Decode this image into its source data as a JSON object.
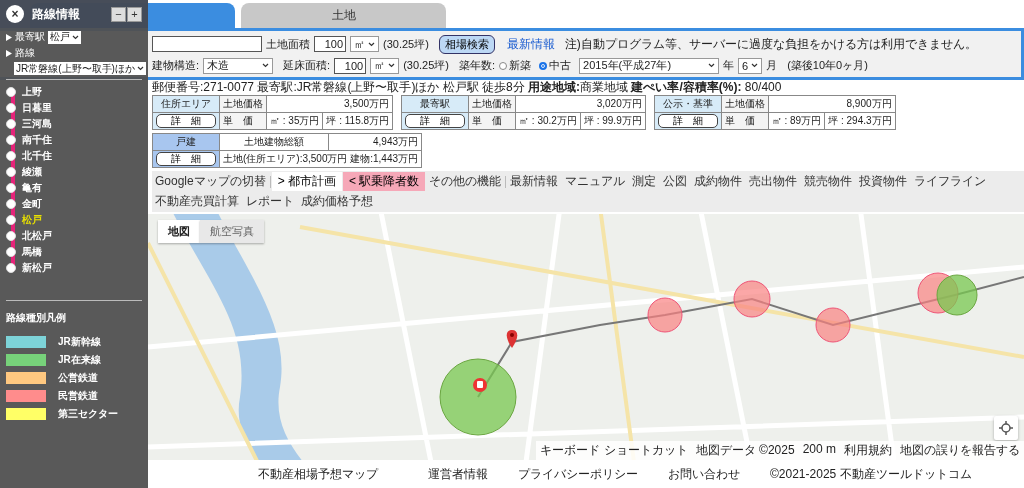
{
  "tabs": [
    {
      "selected": true
    },
    {
      "label": "土地",
      "selected": false
    }
  ],
  "search_form": {
    "land_area": {
      "label": "土地面積",
      "value": "100",
      "unit": "㎡",
      "tsubo": "(30.25坪)"
    },
    "search_button": "相場検索",
    "news_link": "最新情報",
    "notice": "注)自動プログラム等、サーバーに過度な負担をかける方は利用できません。",
    "structure": {
      "label": "建物構造:",
      "value": "木造"
    },
    "floor_area": {
      "label": "延床面積:",
      "value": "100",
      "unit": "㎡",
      "tsubo": "(30.25坪)"
    },
    "age": {
      "label": "築年数:",
      "options": [
        {
          "label": "新築",
          "selected": false
        },
        {
          "label": "中古",
          "selected": true
        }
      ],
      "year": "2015年(平成27年)",
      "year_unit": "年",
      "month": "6",
      "month_unit": "月",
      "elapsed": "(築後10年0ヶ月)"
    }
  },
  "info_line": "郵便番号:271-0077 最寄駅:JR常磐線(上野〜取手)ほか 松戸駅 徒歩8分 **用途地域:**商業地域 **建ぺい率/容積率(%):** 80/400",
  "price_cards": [
    {
      "kind": "land",
      "title": "住所エリア",
      "button": "詳　細",
      "price_label": "土地価格",
      "price": "3,500万円",
      "unit_label": "単　価",
      "sqm": "㎡ : 35万円",
      "tsubo": "坪 : 115.8万円"
    },
    {
      "kind": "land",
      "title": "最寄駅",
      "button": "詳　細",
      "price_label": "土地価格",
      "price": "3,020万円",
      "unit_label": "単　価",
      "sqm": "㎡ : 30.2万円",
      "tsubo": "坪 : 99.9万円"
    },
    {
      "kind": "land",
      "title": "公示・基準",
      "button": "詳　細",
      "price_label": "土地価格",
      "price": "8,900万円",
      "unit_label": "単　価",
      "sqm": "㎡ : 89万円",
      "tsubo": "坪 : 294.3万円"
    },
    {
      "kind": "house",
      "title": "戸建",
      "button": "詳　細",
      "total_label": "土地建物総額",
      "total": "4,943万円",
      "breakdown": "土地(住所エリア):3,500万円 建物:1,443万円"
    }
  ],
  "toolbar": {
    "map_switch": "Googleマップの切替",
    "layers": [
      {
        "arrow": ">",
        "label": "都市計画",
        "selected": false
      },
      {
        "arrow": "<",
        "label": "駅乗降者数",
        "selected": true
      }
    ],
    "more": "その他の機能",
    "menu": [
      "最新情報",
      "マニュアル",
      "測定",
      "公図",
      "成約物件",
      "売出物件",
      "競売物件",
      "投資物件",
      "ライフライン",
      "不動産売買計算",
      "レポート",
      "成約価格予想"
    ]
  },
  "map": {
    "layer_buttons": [
      {
        "label": "地図",
        "selected": true
      },
      {
        "label": "航空写真",
        "selected": false
      }
    ],
    "attribution": [
      "キーボード ショートカット",
      "地図データ ©2025",
      "200 m",
      "利用規約",
      "地図の誤りを報告する"
    ]
  },
  "route_panel": {
    "close": "×",
    "title": "路線情報",
    "zoom_out": "−",
    "zoom_in": "+",
    "nearest_label": "最寄駅",
    "nearest_value": "松戸",
    "line_label": "路線",
    "line_value": "JR常磐線(上野〜取手)ほか",
    "stations": [
      {
        "name": "上野",
        "selected": false
      },
      {
        "name": "日暮里",
        "selected": false
      },
      {
        "name": "三河島",
        "selected": false
      },
      {
        "name": "南千住",
        "selected": false
      },
      {
        "name": "北千住",
        "selected": false
      },
      {
        "name": "綾瀬",
        "selected": false
      },
      {
        "name": "亀有",
        "selected": false
      },
      {
        "name": "金町",
        "selected": false
      },
      {
        "name": "松戸",
        "selected": true
      },
      {
        "name": "北松戸",
        "selected": false
      },
      {
        "name": "馬橋",
        "selected": false
      },
      {
        "name": "新松戸",
        "selected": false
      }
    ],
    "legend_title": "路線種別凡例",
    "legend": [
      {
        "label": "JR新幹線",
        "color": "#7dd3d8"
      },
      {
        "label": "JR在来線",
        "color": "#77d27a"
      },
      {
        "label": "公営鉄道",
        "color": "#ffc880"
      },
      {
        "label": "民営鉄道",
        "color": "#ff8c8c"
      },
      {
        "label": "第三セクター",
        "color": "#ffff66"
      }
    ]
  },
  "footer": {
    "title": "不動産相場予想マップ",
    "links": [
      "運営者情報",
      "プライバシーポリシー",
      "お問い合わせ"
    ],
    "copyright": "©2021-2025 不動産ツールドットコム"
  }
}
